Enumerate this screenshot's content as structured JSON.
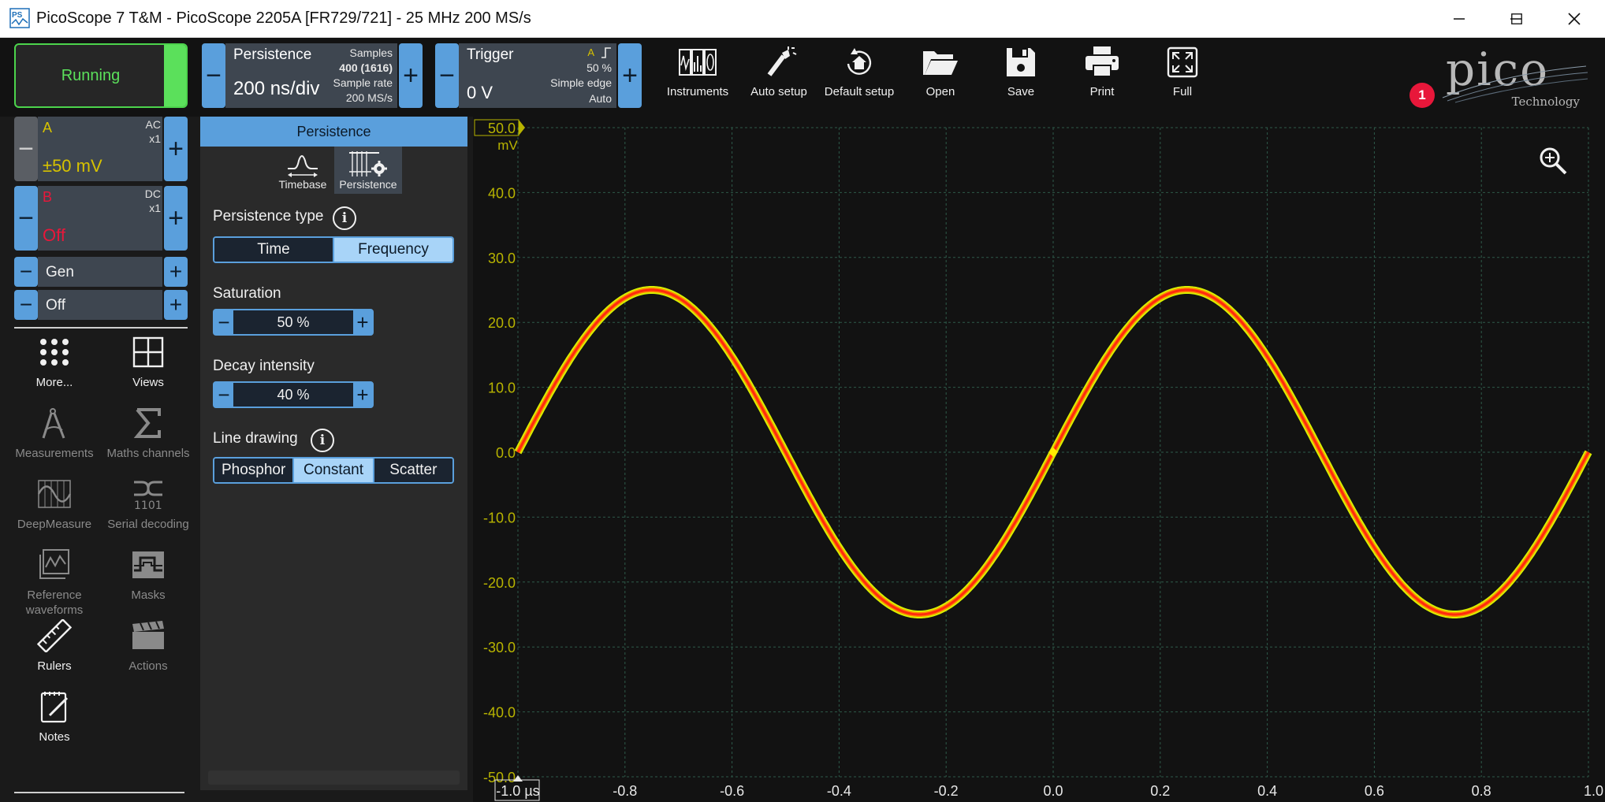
{
  "window": {
    "title": "PicoScope 7 T&M  - PicoScope 2205A [FR729/721] - 25 MHz 200 MS/s",
    "icon": "picoscope-app-icon",
    "controls": [
      "minimize-icon",
      "maximize-icon",
      "close-icon"
    ]
  },
  "toolbar": {
    "run_state": "Running",
    "timebase": {
      "title": "Persistence",
      "value": "200 ns/div",
      "samples_label": "Samples",
      "samples_value": "400 (1616)",
      "rate_label": "Sample rate",
      "rate_value": "200 MS/s"
    },
    "trigger": {
      "title": "Trigger",
      "value": "0 V",
      "channel": "A",
      "level": "50 %",
      "type": "Simple edge",
      "mode": "Auto"
    },
    "tools": [
      {
        "label": "Instruments",
        "icon": "instruments-icon"
      },
      {
        "label": "Auto setup",
        "icon": "auto-setup-icon"
      },
      {
        "label": "Default setup",
        "icon": "default-setup-icon"
      },
      {
        "label": "Open",
        "icon": "folder-open-icon"
      },
      {
        "label": "Save",
        "icon": "save-icon"
      },
      {
        "label": "Print",
        "icon": "print-icon"
      },
      {
        "label": "Full",
        "icon": "fullscreen-icon"
      }
    ],
    "logo_text": "pico",
    "logo_sub": "Technology",
    "notification_count": "1"
  },
  "channels": {
    "a": {
      "name": "A",
      "coupling": "AC",
      "probe": "x1",
      "range": "±50 mV"
    },
    "b": {
      "name": "B",
      "coupling": "DC",
      "probe": "x1",
      "range": "Off"
    },
    "gen": {
      "label": "Gen",
      "state": "Off"
    }
  },
  "sidebar_tools": [
    {
      "label": "More...",
      "icon": "more-dots-icon",
      "enabled": true
    },
    {
      "label": "Views",
      "icon": "views-grid-icon",
      "enabled": true
    },
    {
      "label": "Measurements",
      "icon": "measurements-icon",
      "enabled": false
    },
    {
      "label": "Maths channels",
      "icon": "sigma-icon",
      "enabled": false
    },
    {
      "label": "DeepMeasure",
      "icon": "deepmeasure-icon",
      "enabled": false
    },
    {
      "label": "Serial decoding",
      "icon": "serial-decoding-icon",
      "enabled": false
    },
    {
      "label": "Reference waveforms",
      "icon": "reference-waveforms-icon",
      "enabled": false
    },
    {
      "label": "Masks",
      "icon": "masks-icon",
      "enabled": false
    },
    {
      "label": "Rulers",
      "icon": "ruler-icon",
      "enabled": true
    },
    {
      "label": "Actions",
      "icon": "actions-icon",
      "enabled": false
    },
    {
      "label": "Notes",
      "icon": "notes-icon",
      "enabled": true
    }
  ],
  "panel": {
    "header": "Persistence",
    "tabs": [
      {
        "label": "Timebase",
        "icon": "timebase-icon"
      },
      {
        "label": "Persistence",
        "icon": "persistence-icon"
      }
    ],
    "persistence_type": {
      "label": "Persistence type",
      "options": [
        "Time",
        "Frequency"
      ],
      "selected": "Frequency"
    },
    "saturation": {
      "label": "Saturation",
      "value": "50 %"
    },
    "decay": {
      "label": "Decay intensity",
      "value": "40 %"
    },
    "line_drawing": {
      "label": "Line drawing",
      "options": [
        "Phosphor",
        "Constant",
        "Scatter"
      ],
      "selected": "Constant"
    }
  },
  "chart_data": {
    "type": "line",
    "title": "",
    "xlabel": "",
    "ylabel": "",
    "y_unit": "mV",
    "x_unit": "µs",
    "xlim": [
      -1.0,
      1.0
    ],
    "ylim": [
      -50.0,
      50.0
    ],
    "y_ticks": [
      "50.0",
      "40.0",
      "30.0",
      "20.0",
      "10.0",
      "0.0",
      "-10.0",
      "-20.0",
      "-30.0",
      "-40.0",
      "-50.0"
    ],
    "x_ticks": [
      "-1.0 µs",
      "-0.8",
      "-0.6",
      "-0.4",
      "-0.2",
      "0.0",
      "0.2",
      "0.4",
      "0.6",
      "0.8",
      "1.0"
    ],
    "grid": true,
    "series": [
      {
        "channel": "A",
        "signal": "sine",
        "amplitude": 25.0,
        "frequency_mhz": 1.0,
        "phase": 0,
        "color_core": "#ff2a10",
        "color_edge": "#d8f000"
      }
    ],
    "trigger_marker": {
      "x": 0.0,
      "y": 0.0,
      "color": "#ffea00"
    },
    "axis_color": "#b8b400",
    "grid_color": "#2e5a4a"
  }
}
